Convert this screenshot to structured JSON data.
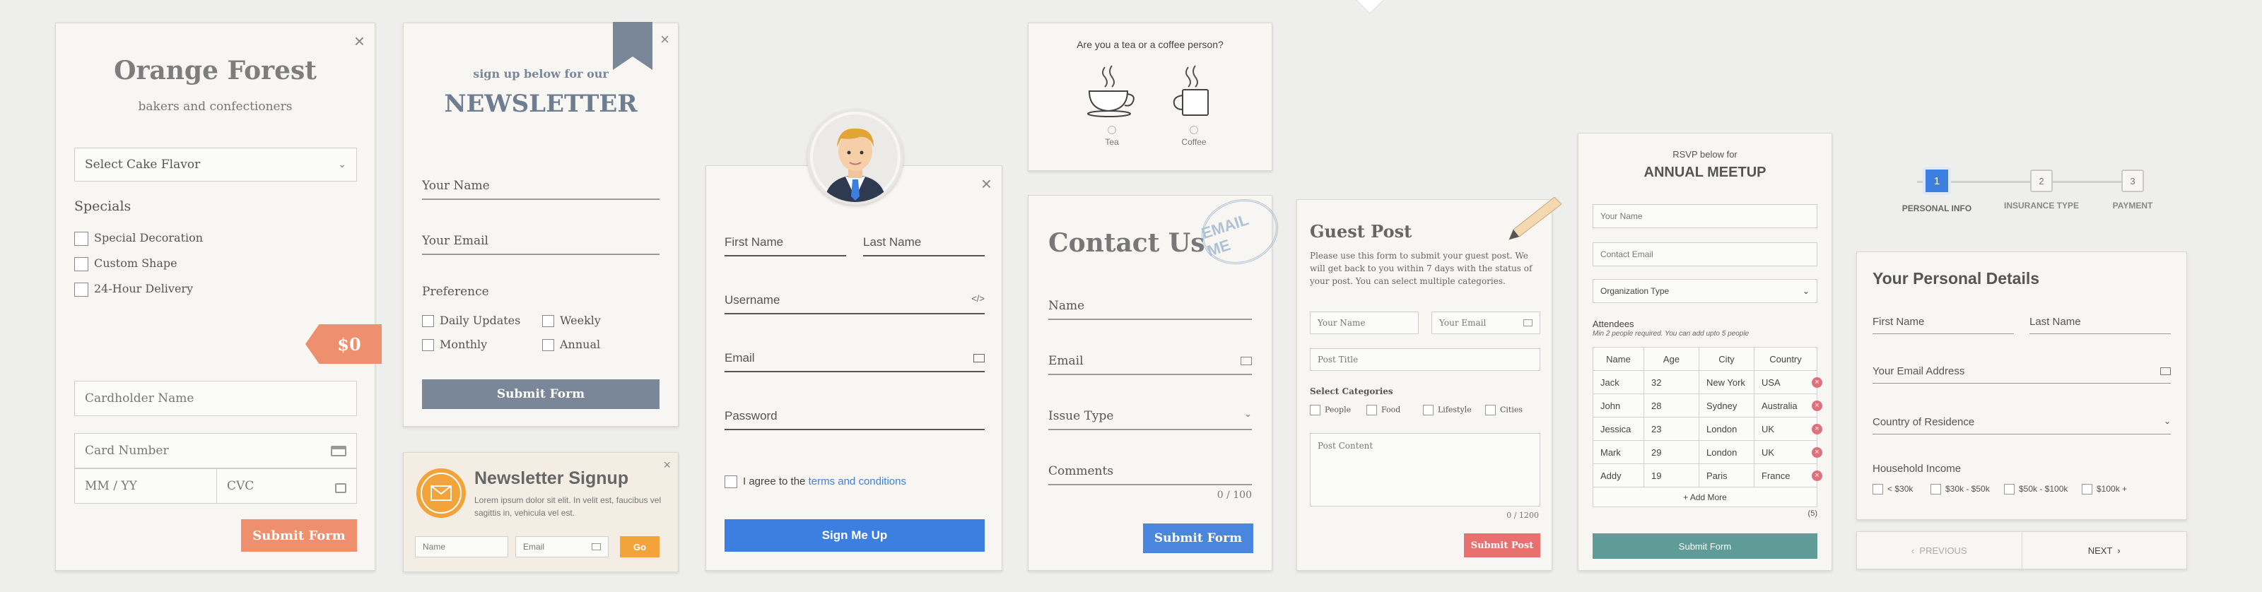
{
  "colors": {
    "orange": "#ee8f6d",
    "slate": "#7a8798",
    "blue": "#3d7fe0",
    "teal": "#5f9c97",
    "pink": "#e8716f",
    "gold": "#f2a43a"
  },
  "cake": {
    "title": "Orange Forest",
    "subtitle": "bakers and confectioners",
    "select": "Select Cake Flavor",
    "specials_heading": "Specials",
    "specials": [
      "Special Decoration",
      "Custom Shape",
      "24-Hour Delivery"
    ],
    "price": "$0",
    "cardholder": "Cardholder Name",
    "card_number": "Card Number",
    "expiry": "MM / YY",
    "cvc": "CVC",
    "submit": "Submit Form"
  },
  "newsletter": {
    "pre": "sign up below for our",
    "title": "NEWSLETTER",
    "name": "Your Name",
    "email": "Your Email",
    "pref_heading": "Preference",
    "prefs": [
      "Daily Updates",
      "Weekly",
      "Monthly",
      "Annual"
    ],
    "submit": "Submit Form"
  },
  "signup_small": {
    "title": "Newsletter Signup",
    "body": "Lorem ipsum dolor sit elit. In velit est, faucibus vel sagittis in, vehicula vel est.",
    "name": "Name",
    "email": "Email",
    "go": "Go"
  },
  "register": {
    "first": "First Name",
    "last": "Last Name",
    "username": "Username",
    "email": "Email",
    "password": "Password",
    "agree": "I agree to the ",
    "terms": "terms and conditions",
    "submit": "Sign Me Up"
  },
  "poll": {
    "question": "Are you a tea or a coffee person?",
    "options": [
      "Tea",
      "Coffee"
    ]
  },
  "contact": {
    "title": "Contact Us",
    "stamp": "EMAIL ME",
    "name": "Name",
    "email": "Email",
    "issue": "Issue Type",
    "comments": "Comments",
    "counter": "0 / 100",
    "submit": "Submit Form"
  },
  "guest": {
    "title": "Guest Post",
    "desc": "Please use this form to submit your guest post. We will get back to you within 7 days with the status of your post. You can select multiple categories.",
    "name": "Your Name",
    "email": "Your Email",
    "post_title": "Post Title",
    "cat_heading": "Select Categories",
    "cats": [
      "People",
      "Food",
      "Lifestyle",
      "Cities"
    ],
    "content": "Post Content",
    "counter": "0 / 1200",
    "submit": "Submit Post"
  },
  "rsvp": {
    "pre": "RSVP below for",
    "title": "ANNUAL MEETUP",
    "name": "Your Name",
    "email": "Contact Email",
    "org": "Organization Type",
    "att_heading": "Attendees",
    "att_note": "Min 2 people required. You can add upto 5 people",
    "columns": [
      "Name",
      "Age",
      "City",
      "Country"
    ],
    "rows": [
      [
        "Jack",
        "32",
        "New York",
        "USA"
      ],
      [
        "John",
        "28",
        "Sydney",
        "Australia"
      ],
      [
        "Jessica",
        "23",
        "London",
        "UK"
      ],
      [
        "Mark",
        "29",
        "London",
        "UK"
      ],
      [
        "Addy",
        "19",
        "Paris",
        "France"
      ]
    ],
    "add_more": "+ Add More",
    "count": "(5)",
    "submit": "Submit Form"
  },
  "wizard": {
    "steps": [
      {
        "num": "1",
        "label": "PERSONAL INFO"
      },
      {
        "num": "2",
        "label": "INSURANCE TYPE"
      },
      {
        "num": "3",
        "label": "PAYMENT"
      }
    ],
    "title": "Your Personal Details",
    "first": "First Name",
    "last": "Last Name",
    "email": "Your Email Address",
    "country": "Country of Residence",
    "income_heading": "Household Income",
    "incomes": [
      "< $30k",
      "$30k - $50k",
      "$50k - $100k",
      "$100k +"
    ],
    "prev": "‹  PREVIOUS",
    "next": "NEXT  ›"
  }
}
